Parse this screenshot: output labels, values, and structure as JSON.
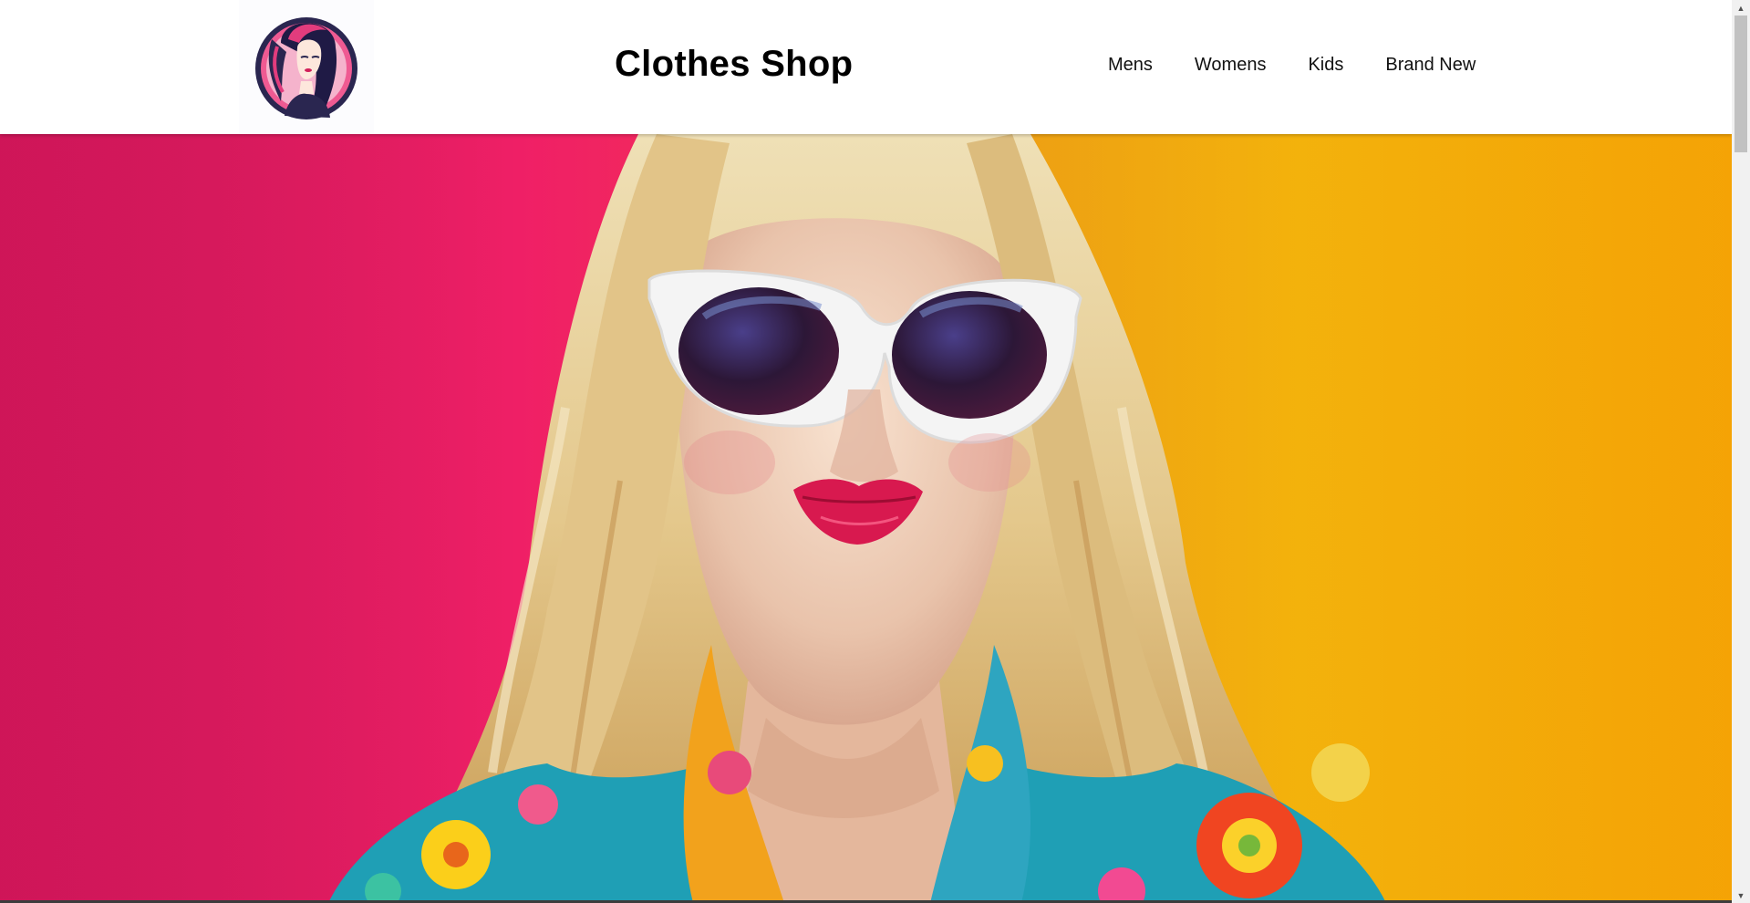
{
  "header": {
    "logo_icon": "woman-portrait-logo-icon",
    "title": "Clothes Shop",
    "nav": [
      {
        "label": "Mens"
      },
      {
        "label": "Womens"
      },
      {
        "label": "Kids"
      },
      {
        "label": "Brand New"
      }
    ]
  },
  "hero": {
    "image": "hero-model-sunglasses-image",
    "colors": {
      "left_wall": "#ec1e66",
      "right_wall": "#fcb40a",
      "hair": "#e6cc93",
      "lips": "#d8194f"
    }
  },
  "scrollbar": {
    "up_icon": "scroll-up-arrow-icon",
    "down_icon": "scroll-down-arrow-icon"
  }
}
